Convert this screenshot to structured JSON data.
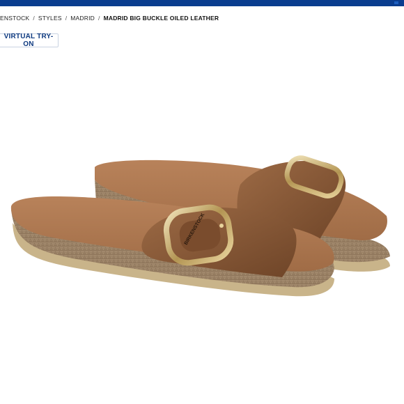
{
  "header": {
    "bar_color": "#0a3d8f"
  },
  "breadcrumb": {
    "items": [
      "ENSTOCK",
      "STYLES",
      "MADRID"
    ],
    "separator": "/",
    "current": "MADRID BIG BUCKLE OILED LEATHER"
  },
  "virtual_try_on": {
    "label": "VIRTUAL TRY-ON"
  },
  "product_image": {
    "description_icon": "sandal-pair-image",
    "buckle_text": "BIRKENSTOCK",
    "leather_color": "#8a5a38",
    "footbed_color": "#b47a52",
    "cork_color": "#9c8267",
    "sole_color": "#c9b48a"
  }
}
